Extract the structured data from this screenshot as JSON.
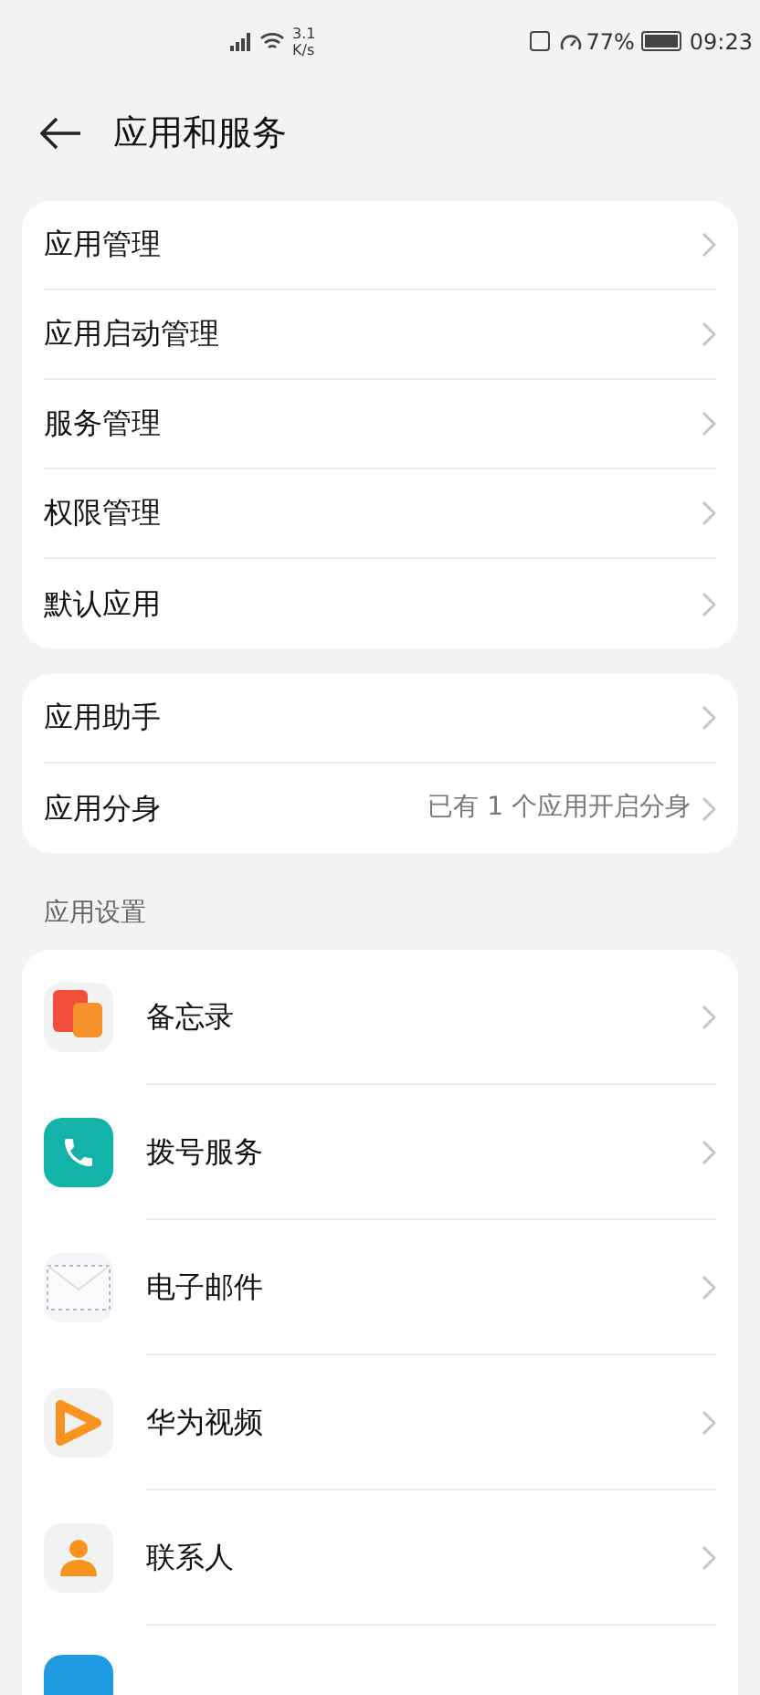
{
  "status_bar": {
    "speed_value": "3.1",
    "speed_unit": "K/s",
    "battery": "77%",
    "time": "09:23"
  },
  "header": {
    "title": "应用和服务"
  },
  "groups": [
    {
      "items": [
        {
          "label": "应用管理"
        },
        {
          "label": "应用启动管理"
        },
        {
          "label": "服务管理"
        },
        {
          "label": "权限管理"
        },
        {
          "label": "默认应用"
        }
      ]
    },
    {
      "items": [
        {
          "label": "应用助手"
        },
        {
          "label": "应用分身",
          "value": "已有 1 个应用开启分身"
        }
      ]
    }
  ],
  "app_settings": {
    "heading": "应用设置",
    "items": [
      {
        "label": "备忘录"
      },
      {
        "label": "拨号服务"
      },
      {
        "label": "电子邮件"
      },
      {
        "label": "华为视频"
      },
      {
        "label": "联系人"
      }
    ]
  }
}
